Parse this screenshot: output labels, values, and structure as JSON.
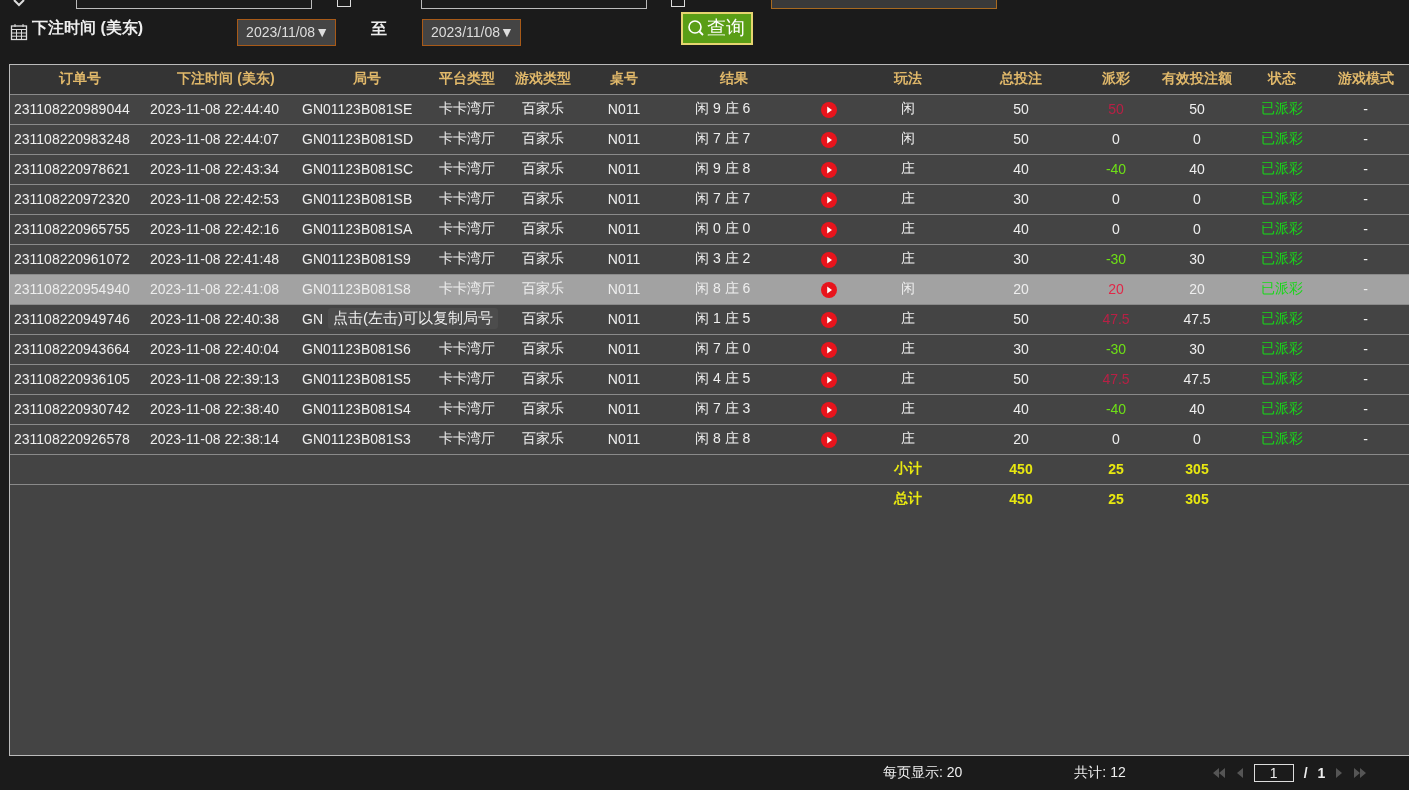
{
  "filters": {
    "date_label": "下注时间 (美东)",
    "start_date": "2023/11/08▼",
    "range_word": "至",
    "end_date": "2023/11/08▼",
    "query_button": "查询"
  },
  "table": {
    "columns": [
      "订单号",
      "下注时间 (美东)",
      "局号",
      "平台类型",
      "游戏类型",
      "桌号",
      "结果",
      "",
      "玩法",
      "总投注",
      "派彩",
      "有效投注额",
      "状态",
      "游戏模式"
    ],
    "rows": [
      {
        "order": "231108220989044",
        "time": "2023-11-08 22:44:40",
        "round": "GN01123B081SE",
        "platform": "卡卡湾厅",
        "game": "百家乐",
        "table": "N011",
        "result": "闲 9 庄 6",
        "play": "闲",
        "total": "50",
        "payout": "50",
        "color": "#b82045",
        "valid": "50",
        "status": "已派彩",
        "mode": "-",
        "selected": false
      },
      {
        "order": "231108220983248",
        "time": "2023-11-08 22:44:07",
        "round": "GN01123B081SD",
        "platform": "卡卡湾厅",
        "game": "百家乐",
        "table": "N011",
        "result": "闲 7 庄 7",
        "play": "闲",
        "total": "50",
        "payout": "0",
        "color": "#eeeeee",
        "valid": "0",
        "status": "已派彩",
        "mode": "-",
        "selected": false
      },
      {
        "order": "231108220978621",
        "time": "2023-11-08 22:43:34",
        "round": "GN01123B081SC",
        "platform": "卡卡湾厅",
        "game": "百家乐",
        "table": "N011",
        "result": "闲 9 庄 8",
        "play": "庄",
        "total": "40",
        "payout": "-40",
        "color": "#6ee016",
        "valid": "40",
        "status": "已派彩",
        "mode": "-",
        "selected": false
      },
      {
        "order": "231108220972320",
        "time": "2023-11-08 22:42:53",
        "round": "GN01123B081SB",
        "platform": "卡卡湾厅",
        "game": "百家乐",
        "table": "N011",
        "result": "闲 7 庄 7",
        "play": "庄",
        "total": "30",
        "payout": "0",
        "color": "#eeeeee",
        "valid": "0",
        "status": "已派彩",
        "mode": "-",
        "selected": false
      },
      {
        "order": "231108220965755",
        "time": "2023-11-08 22:42:16",
        "round": "GN01123B081SA",
        "platform": "卡卡湾厅",
        "game": "百家乐",
        "table": "N011",
        "result": "闲 0 庄 0",
        "play": "庄",
        "total": "40",
        "payout": "0",
        "color": "#eeeeee",
        "valid": "0",
        "status": "已派彩",
        "mode": "-",
        "selected": false
      },
      {
        "order": "231108220961072",
        "time": "2023-11-08 22:41:48",
        "round": "GN01123B081S9",
        "platform": "卡卡湾厅",
        "game": "百家乐",
        "table": "N011",
        "result": "闲 3 庄 2",
        "play": "庄",
        "total": "30",
        "payout": "-30",
        "color": "#6ee016",
        "valid": "30",
        "status": "已派彩",
        "mode": "-",
        "selected": false
      },
      {
        "order": "231108220954940",
        "time": "2023-11-08 22:41:08",
        "round": "GN01123B081S8",
        "platform": "卡卡湾厅",
        "game": "百家乐",
        "table": "N011",
        "result": "闲 8 庄 6",
        "play": "闲",
        "total": "20",
        "payout": "20",
        "color": "#e02848",
        "valid": "20",
        "status": "已派彩",
        "mode": "-",
        "selected": true
      },
      {
        "order": "231108220949746",
        "time": "2023-11-08 22:40:38",
        "round": "GN",
        "tooltip": "点击(左击)可以复制局号",
        "game": "百家乐",
        "table": "N011",
        "result": "闲 1 庄 5",
        "play": "庄",
        "total": "50",
        "payout": "47.5",
        "color": "#b82045",
        "valid": "47.5",
        "status": "已派彩",
        "mode": "-",
        "selected": false
      },
      {
        "order": "231108220943664",
        "time": "2023-11-08 22:40:04",
        "round": "GN01123B081S6",
        "platform": "卡卡湾厅",
        "game": "百家乐",
        "table": "N011",
        "result": "闲 7 庄 0",
        "play": "庄",
        "total": "30",
        "payout": "-30",
        "color": "#6ee016",
        "valid": "30",
        "status": "已派彩",
        "mode": "-",
        "selected": false
      },
      {
        "order": "231108220936105",
        "time": "2023-11-08 22:39:13",
        "round": "GN01123B081S5",
        "platform": "卡卡湾厅",
        "game": "百家乐",
        "table": "N011",
        "result": "闲 4 庄 5",
        "play": "庄",
        "total": "50",
        "payout": "47.5",
        "color": "#b82045",
        "valid": "47.5",
        "status": "已派彩",
        "mode": "-",
        "selected": false
      },
      {
        "order": "231108220930742",
        "time": "2023-11-08 22:38:40",
        "round": "GN01123B081S4",
        "platform": "卡卡湾厅",
        "game": "百家乐",
        "table": "N011",
        "result": "闲 7 庄 3",
        "play": "庄",
        "total": "40",
        "payout": "-40",
        "color": "#6ee016",
        "valid": "40",
        "status": "已派彩",
        "mode": "-",
        "selected": false
      },
      {
        "order": "231108220926578",
        "time": "2023-11-08 22:38:14",
        "round": "GN01123B081S3",
        "platform": "卡卡湾厅",
        "game": "百家乐",
        "table": "N011",
        "result": "闲 8 庄 8",
        "play": "庄",
        "total": "20",
        "payout": "0",
        "color": "#eeeeee",
        "valid": "0",
        "status": "已派彩",
        "mode": "-",
        "selected": false
      }
    ],
    "totals": [
      {
        "label": "小计",
        "total": "450",
        "payout": "25",
        "valid": "305"
      },
      {
        "label": "总计",
        "total": "450",
        "payout": "25",
        "valid": "305"
      }
    ]
  },
  "footer": {
    "page_size": "每页显示: 20",
    "count": "共计: 12",
    "page": "1",
    "separator": "/",
    "pages": "1"
  }
}
